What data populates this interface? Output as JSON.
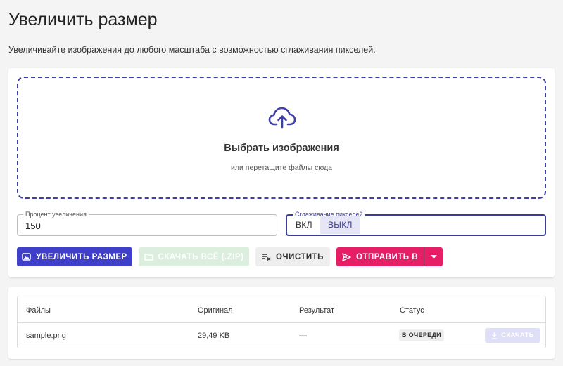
{
  "page": {
    "title": "Увеличить размер",
    "subtitle": "Увеличивайте изображения до любого масштаба с возможностью сглаживания пикселей."
  },
  "dropzone": {
    "icon": "cloud-upload-icon",
    "title": "Выбрать изображения",
    "hint": "или перетащите файлы сюда"
  },
  "settings": {
    "percent_label": "Процент увеличения",
    "percent_value": "150",
    "smoothing_label": "Сглаживание пикселей",
    "smoothing_on": "ВКЛ",
    "smoothing_off": "ВЫКЛ",
    "smoothing_selected": "ВЫКЛ"
  },
  "actions": {
    "upscale": "УВЕЛИЧИТЬ РАЗМЕР",
    "download_all": "СКАЧАТЬ ВСЁ (.ZIP)",
    "clear": "ОЧИСТИТЬ",
    "send": "ОТПРАВИТЬ В"
  },
  "table": {
    "headers": [
      "Файлы",
      "Оригинал",
      "Результат",
      "Статус"
    ],
    "rows": [
      {
        "file": "sample.png",
        "original": "29,49 KB",
        "result": "—",
        "status": "В ОЧЕРЕДИ",
        "download": "СКАЧАТЬ"
      }
    ]
  },
  "colors": {
    "primary": "#3f3fc9",
    "accent": "#e61e66",
    "disabled_green": "#dcefdf",
    "dropzone_border": "#3f3fa9"
  }
}
